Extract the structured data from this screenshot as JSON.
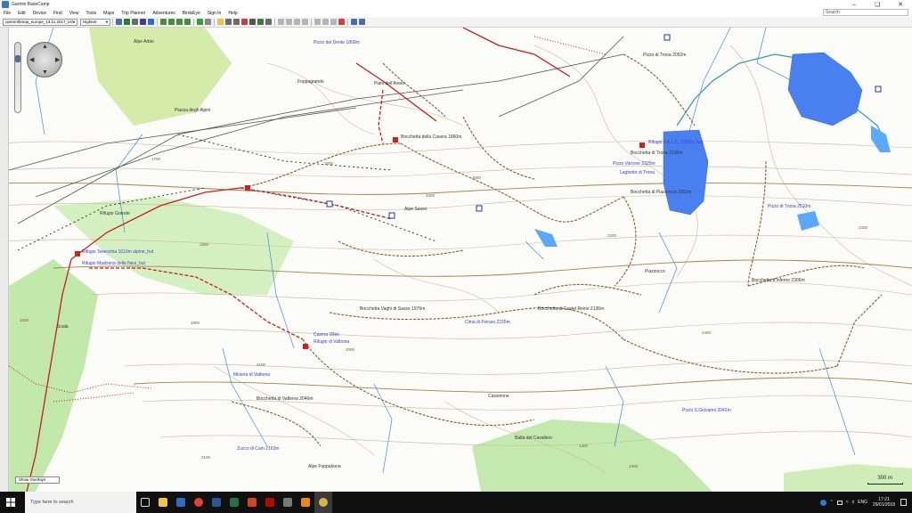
{
  "window": {
    "title": "Garmin BaseCamp"
  },
  "menu": [
    "File",
    "Edit",
    "Device",
    "Find",
    "View",
    "Tools",
    "Maps",
    "Trip Planner",
    "Adventures",
    "BirdsEye",
    "Sign In",
    "Help"
  ],
  "search": {
    "placeholder": "Search"
  },
  "toolbar": {
    "map_select": "openmtbmap_europe_13.11.2017_UC",
    "detail_select": "Highest"
  },
  "map": {
    "overlays_button": "Show Overlays",
    "scale_label": "300 m",
    "labels": {
      "alpe_arbio": "Alpe Arbio",
      "pizzo_del_dente": "Pizzo del Dente 1809m",
      "foppagrande": "Foppagrande",
      "piani_dell_avaro": "Piani dell'Avaro",
      "piazza_degli_alpini": "Piazza degli Alpini",
      "bocchetta_della_casera": "Bocchetta della Casera 1860m",
      "pizzo_di_trona": "Pizzo di Trona 2052m",
      "rifugio_falc": "Rifugio F.A.L.C. 2120m_hut",
      "bocchetta_di_trona": "Bocchetta di Trona 2126m",
      "pizzo_varrone": "Pizzo Varrone 2325m",
      "laghetto_trona": "Laghetto di Trona",
      "bocchetta_piazzocco": "Bocchetta di Piazzocco 2252m",
      "pizzo_di_trona_2": "Pizzo di Trona 2510m",
      "alpe_sasso": "Alpe Sasso",
      "piazzocco": "Piazzocco",
      "bocchetta_inferno": "Bocchetta d'Inferno 2306m",
      "rifugio_benigni": "Rifugio Grande",
      "rifugio_tavecchia": "Rifugio Tavecchia 1610m alpine_hut",
      "rifugio_madonna": "Rifugio Madonna delle Nevi_hut",
      "bocchetta_sasso": "Bocchetta Vaghi di Sasso 1976m",
      "cima_fioraro": "Cima di Fioraro 2155m",
      "bocchetta_castel_reino": "Bocchetta di Castel Reino 2136m",
      "scala": "Scala",
      "casera_ollini": "Casera Ollini",
      "rifugio_valbona": "Rifugio di Valbona",
      "miniera": "Miniera di Valbona",
      "bocchetta_valbona": "Bocchetta di Valbona 2046m",
      "cassinone": "Cassinone",
      "pizzo_s_giovanni": "Pizzo S.Giovanni 2042m",
      "baita_cavallero": "Baita del Cavallero",
      "zucco_di_cam": "Zucco di Cam 2163m",
      "alpe_foppabona": "Alpe Foppabona",
      "c1700a": "1700",
      "c1800a": "1800",
      "c1900a": "1900",
      "c2000a": "2000",
      "c2100a": "2100",
      "c2200a": "2200",
      "c2300a": "2300",
      "c2400a": "2400",
      "c1600a": "1600",
      "c1500a": "1500",
      "c1400a": "1400",
      "c1300a": "1300",
      "c2100b": "2100",
      "c2000b": "2000",
      "c1900b": "1900"
    }
  },
  "taskbar": {
    "search_placeholder": "Type here to search",
    "language": "ENG",
    "time": "17:21",
    "date": "29/01/2018"
  },
  "colors": {
    "taskbar": "#101010",
    "trail_red": "#c81e1e",
    "track_brown": "#8b5a2b",
    "lake": "#4a86ff",
    "grass": "#b7e59c",
    "river": "#3a8ed8"
  }
}
